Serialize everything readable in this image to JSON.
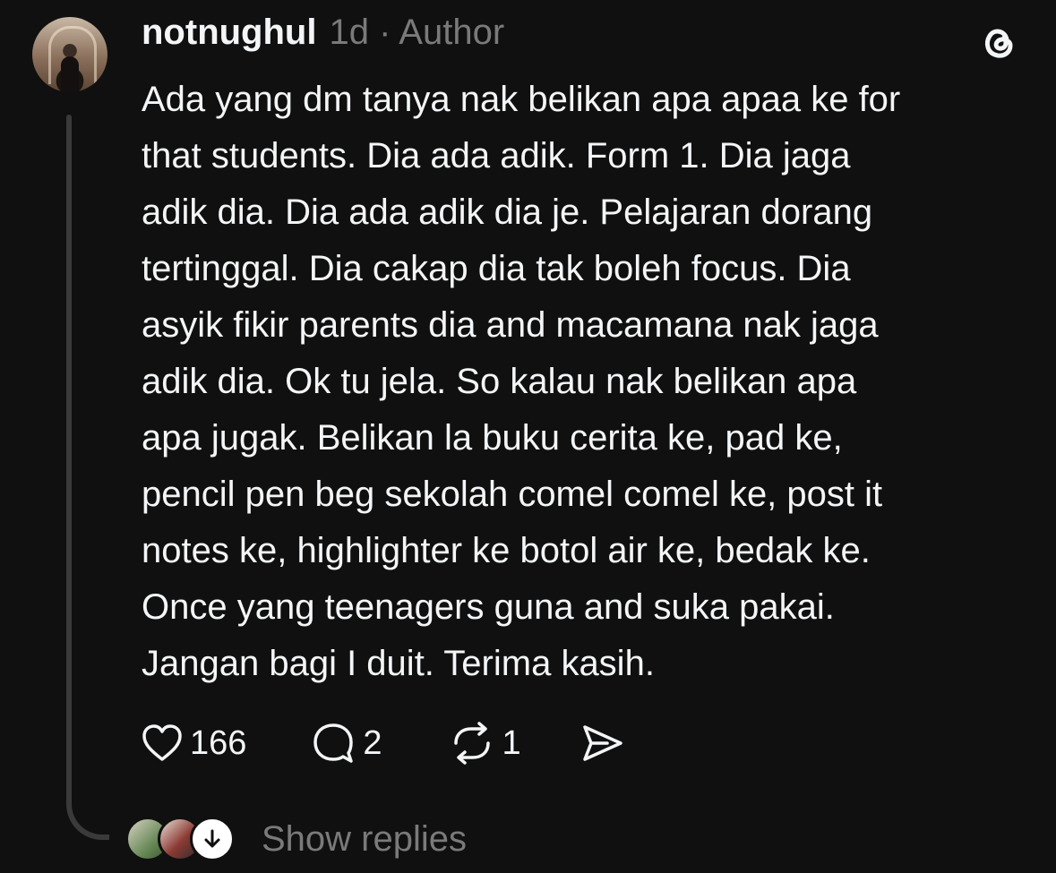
{
  "post": {
    "username": "notnughul",
    "meta": "1d · Author",
    "text": "Ada yang dm tanya nak belikan apa apaa ke for\nthat students. Dia ada adik. Form 1. Dia jaga\nadik dia. Dia ada adik dia je. Pelajaran dorang\ntertinggal. Dia cakap dia tak boleh focus. Dia\nasyik fikir parents dia and macamana nak jaga\nadik dia. Ok tu jela. So kalau nak belikan apa\napa jugak. Belikan la buku cerita ke, pad ke,\npencil pen beg sekolah comel comel ke, post it\nnotes ke, highlighter ke botol air ke, bedak ke.\nOnce yang teenagers guna and suka pakai.\nJangan bagi I duit. Terima kasih."
  },
  "actions": {
    "likes": "166",
    "comments": "2",
    "reposts": "1",
    "icons": [
      "heart-icon",
      "comment-icon",
      "repost-icon",
      "share-icon"
    ]
  },
  "replies": {
    "label": "Show replies"
  },
  "colors": {
    "background": "#101010",
    "text": "#f3f5f7",
    "muted": "#7a7a7a",
    "thread_line": "#3a3a3a"
  }
}
